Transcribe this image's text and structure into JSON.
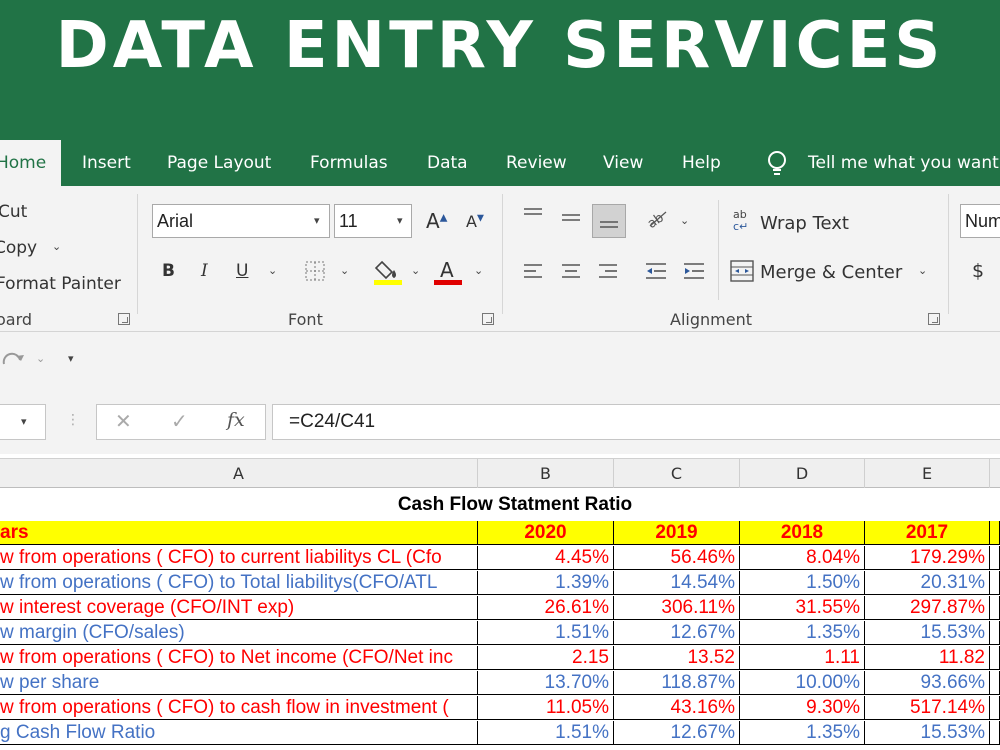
{
  "banner": {
    "title": "DATA ENTRY SERVICES"
  },
  "tabs": [
    {
      "label": "Home",
      "active": true
    },
    {
      "label": "Insert"
    },
    {
      "label": "Page Layout"
    },
    {
      "label": "Formulas"
    },
    {
      "label": "Data"
    },
    {
      "label": "Review"
    },
    {
      "label": "View"
    },
    {
      "label": "Help"
    }
  ],
  "tell_me": "Tell me what you want",
  "clipboard": {
    "cut": "Cut",
    "copy": "Copy",
    "format_painter": "Format Painter",
    "group_label": "oard"
  },
  "font": {
    "name": "Arial",
    "size": "11",
    "group_label": "Font"
  },
  "alignment": {
    "wrap_text": "Wrap Text",
    "merge_center": "Merge & Center",
    "group_label": "Alignment"
  },
  "number": {
    "format": "Num"
  },
  "formula_bar": {
    "formula": "=C24/C41"
  },
  "columns": [
    "A",
    "B",
    "C",
    "D",
    "E"
  ],
  "sheet": {
    "title": "Cash Flow Statment Ratio",
    "years_label": "ars",
    "years": [
      "2020",
      "2019",
      "2018",
      "2017"
    ],
    "rows": [
      {
        "label": "w from operations ( CFO) to current liabilitys CL (Cfo",
        "values": [
          "4.45%",
          "56.46%",
          "8.04%",
          "179.29%"
        ],
        "color": "red"
      },
      {
        "label": "w from operations ( CFO) to Total liabilitys(CFO/ATL",
        "values": [
          "1.39%",
          "14.54%",
          "1.50%",
          "20.31%"
        ],
        "color": "blue"
      },
      {
        "label": "w interest coverage (CFO/INT exp)",
        "values": [
          "26.61%",
          "306.11%",
          "31.55%",
          "297.87%"
        ],
        "color": "red"
      },
      {
        "label": "w margin (CFO/sales)",
        "values": [
          "1.51%",
          "12.67%",
          "1.35%",
          "15.53%"
        ],
        "color": "blue"
      },
      {
        "label": "w from operations ( CFO) to Net income (CFO/Net inc",
        "values": [
          "2.15",
          "13.52",
          "1.11",
          "11.82"
        ],
        "color": "red"
      },
      {
        "label": "w per share",
        "values": [
          "13.70%",
          "118.87%",
          "10.00%",
          "93.66%"
        ],
        "color": "blue"
      },
      {
        "label": "w from operations ( CFO) to cash flow in investment (",
        "values": [
          "11.05%",
          "43.16%",
          "9.30%",
          "517.14%"
        ],
        "color": "red"
      },
      {
        "label": "g Cash Flow Ratio",
        "values": [
          "1.51%",
          "12.67%",
          "1.35%",
          "15.53%"
        ],
        "color": "blue"
      }
    ]
  },
  "colors": {
    "excel_green": "#217346",
    "year_row_bg": "#ffff00",
    "red_text": "#ff0000",
    "blue_text": "#4472c4"
  }
}
